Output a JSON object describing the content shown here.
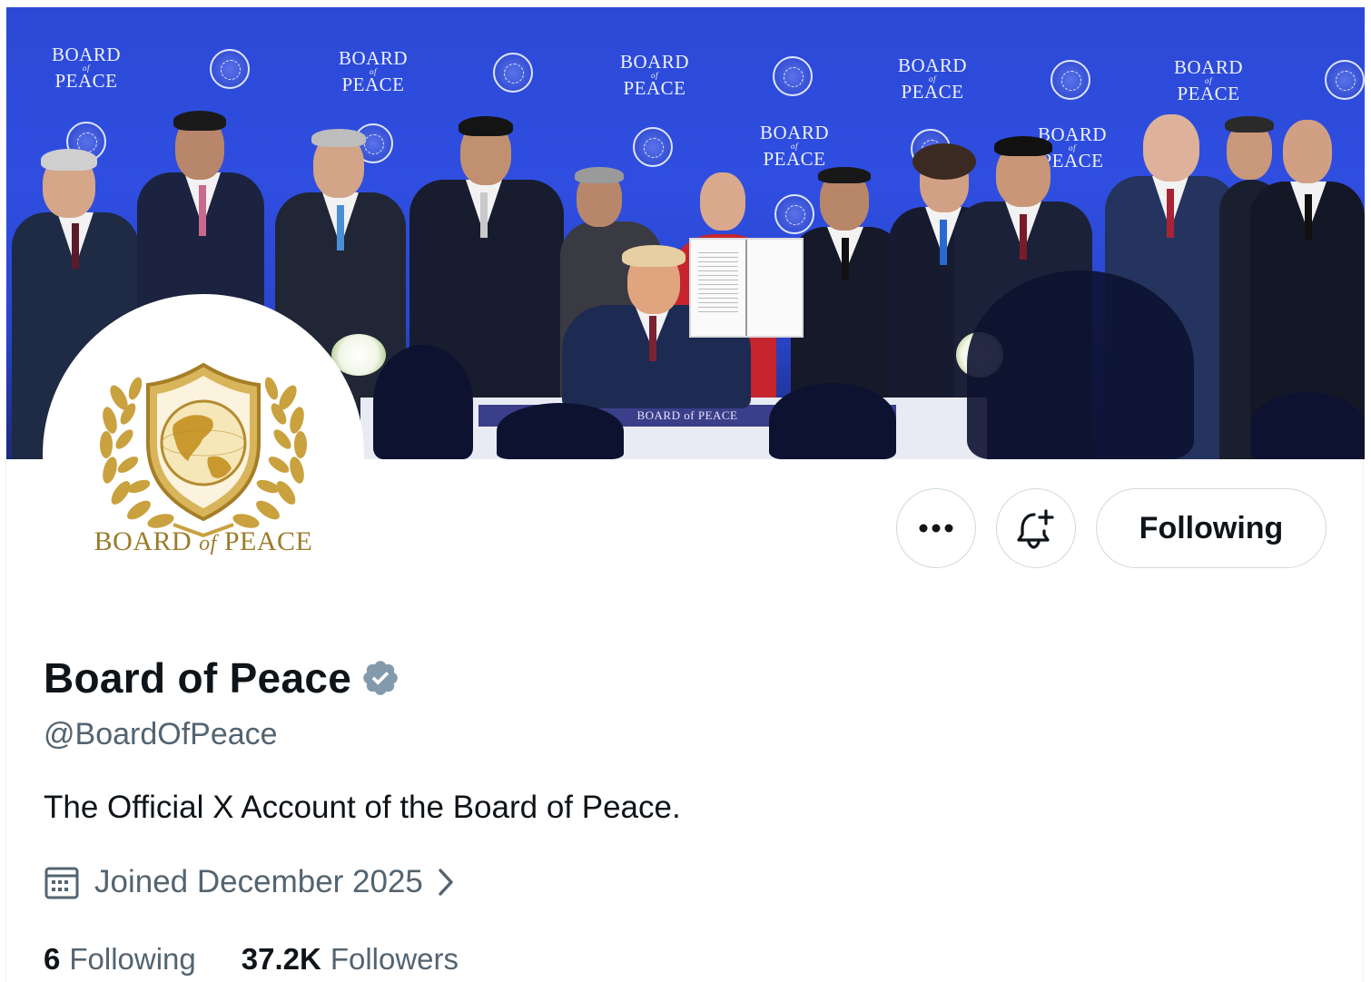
{
  "banner": {
    "backdrop_word_top": "BOARD",
    "backdrop_word_of": "of",
    "backdrop_word_bottom": "PEACE",
    "table_skirt_text": "BOARD of PEACE"
  },
  "avatar": {
    "logo_text_main_1": "BOARD",
    "logo_text_of": "of",
    "logo_text_main_2": "PEACE"
  },
  "actions": {
    "more_icon": "more-horizontal-icon",
    "notify_icon": "bell-plus-icon",
    "follow_label": "Following"
  },
  "profile": {
    "display_name": "Board of Peace",
    "verified_icon": "verified-badge-icon",
    "handle": "@BoardOfPeace",
    "bio": "The Official X Account of the Board of Peace.",
    "joined": "Joined December 2025",
    "following_count": "6",
    "following_label": "Following",
    "followers_count": "37.2K",
    "followers_label": "Followers"
  },
  "colors": {
    "text_primary": "#0f1419",
    "text_secondary": "#536471",
    "border": "#cfd9de",
    "verified_gray": "#829aab",
    "logo_gold": "#9c7b2b",
    "banner_blue": "#2f4ee0"
  }
}
